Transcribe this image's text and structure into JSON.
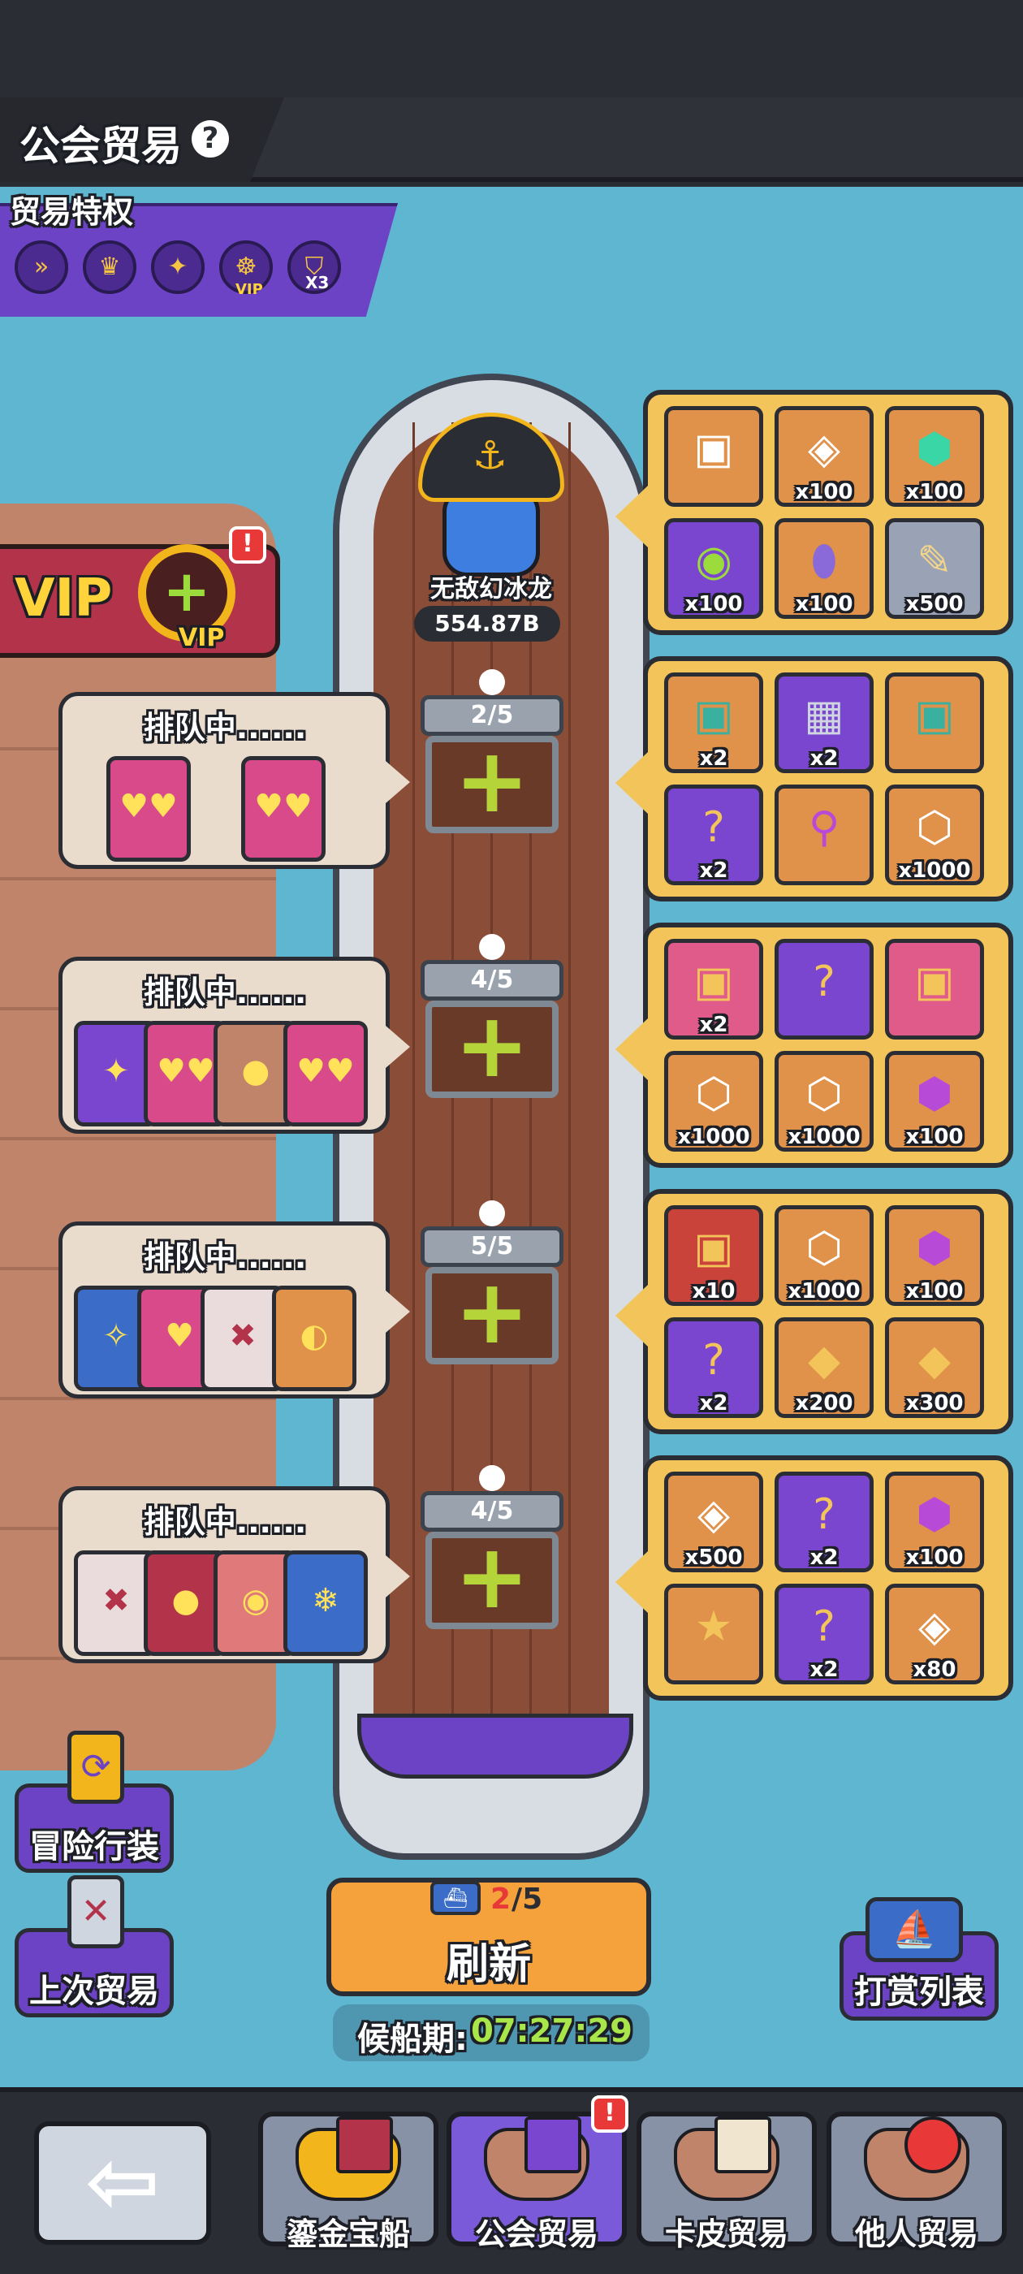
{
  "header": {
    "title": "公会贸易",
    "help_icon": "?"
  },
  "privileges": {
    "title": "贸易特权",
    "items": [
      {
        "icon": "ship-speed-icon",
        "glyph": "»"
      },
      {
        "icon": "crown-up-icon",
        "glyph": "♛"
      },
      {
        "icon": "target-icon",
        "glyph": "✦"
      },
      {
        "icon": "vip-wheel-icon",
        "glyph": "☸",
        "label": "VIP"
      },
      {
        "icon": "shield-x3-icon",
        "glyph": "⛉",
        "label": "X3"
      }
    ]
  },
  "vip": {
    "text": "VIP",
    "wheel_label": "VIP",
    "badge": "!"
  },
  "captain": {
    "name": "无敌幻冰龙",
    "power": "554.87B"
  },
  "queues": [
    {
      "status": "排队中......",
      "count": "2/5"
    },
    {
      "status": "排队中......",
      "count": "4/5"
    },
    {
      "status": "排队中......",
      "count": "5/5"
    },
    {
      "status": "排队中......",
      "count": "4/5"
    }
  ],
  "rewards": [
    [
      {
        "icon": "gold-chest-icon",
        "qty": ""
      },
      {
        "icon": "paw-token-icon",
        "qty": "x100"
      },
      {
        "icon": "emerald-gem-icon",
        "qty": "x100"
      },
      {
        "icon": "guild-coin-icon",
        "qty": "x100"
      },
      {
        "icon": "egg-icon",
        "qty": "x100"
      },
      {
        "icon": "bone-icon",
        "qty": "x500"
      }
    ],
    [
      {
        "icon": "teal-chest-icon",
        "qty": "x2"
      },
      {
        "icon": "armor-chest-icon",
        "qty": "x2"
      },
      {
        "icon": "teal-chest-icon",
        "qty": ""
      },
      {
        "icon": "mystery-chest-icon",
        "qty": "x2"
      },
      {
        "icon": "torch-icon",
        "qty": ""
      },
      {
        "icon": "hex-medal-icon",
        "qty": "x1000"
      }
    ],
    [
      {
        "icon": "pink-chest-icon",
        "qty": "x2"
      },
      {
        "icon": "mystery-gem-chest-icon",
        "qty": ""
      },
      {
        "icon": "pink-chest-icon",
        "qty": ""
      },
      {
        "icon": "hex-medal-icon",
        "qty": "x1000"
      },
      {
        "icon": "hex-medal-icon",
        "qty": "x1000"
      },
      {
        "icon": "purple-gem-icon",
        "qty": "x100"
      }
    ],
    [
      {
        "icon": "red-chest-icon",
        "qty": "x10"
      },
      {
        "icon": "hex-medal-icon",
        "qty": "x1000"
      },
      {
        "icon": "purple-gem-icon",
        "qty": "x100"
      },
      {
        "icon": "mystery-chest-icon",
        "qty": "x2"
      },
      {
        "icon": "ticket-icon",
        "qty": "x200"
      },
      {
        "icon": "ticket-icon",
        "qty": "x300"
      }
    ],
    [
      {
        "icon": "paw-token-icon",
        "qty": "x500"
      },
      {
        "icon": "mystery-chest-icon",
        "qty": "x2"
      },
      {
        "icon": "purple-gem-icon",
        "qty": "x100"
      },
      {
        "icon": "star-chest-icon",
        "qty": ""
      },
      {
        "icon": "mystery-chest-icon",
        "qty": "x2"
      },
      {
        "icon": "paw-token-icon",
        "qty": "x80"
      }
    ]
  ],
  "side_buttons": {
    "adventure_outfit": "冒险行装",
    "last_trade": "上次贸易"
  },
  "refresh": {
    "used": "2",
    "total": "/5",
    "label": "刷新"
  },
  "timer": {
    "label": "候船期:",
    "value": "07:27:29"
  },
  "reward_list_label": "打赏列表",
  "bottom_nav": {
    "back_glyph": "⇦",
    "tabs": [
      {
        "label": "鎏金宝船",
        "active": false
      },
      {
        "label": "公会贸易",
        "active": true,
        "badge": "!"
      },
      {
        "label": "卡皮贸易",
        "active": false
      },
      {
        "label": "他人贸易",
        "active": false
      }
    ]
  }
}
